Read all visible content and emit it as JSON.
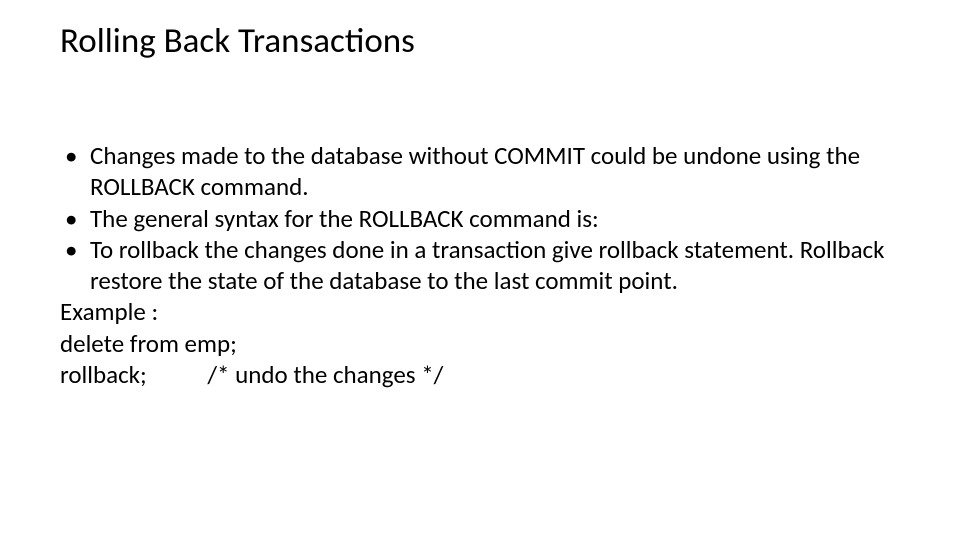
{
  "title": "Rolling Back Transactions",
  "bullets": [
    "Changes made to the database without COMMIT could be undone using the ROLLBACK command.",
    "The general syntax for the ROLLBACK command is:",
    "To rollback the changes done in a transaction give rollback statement. Rollback restore the state of the database to the last commit point."
  ],
  "example_label": "Example :",
  "code": {
    "line1": "delete from emp;",
    "line2_cmd": "rollback;",
    "line2_comment": "/* undo the changes */"
  }
}
